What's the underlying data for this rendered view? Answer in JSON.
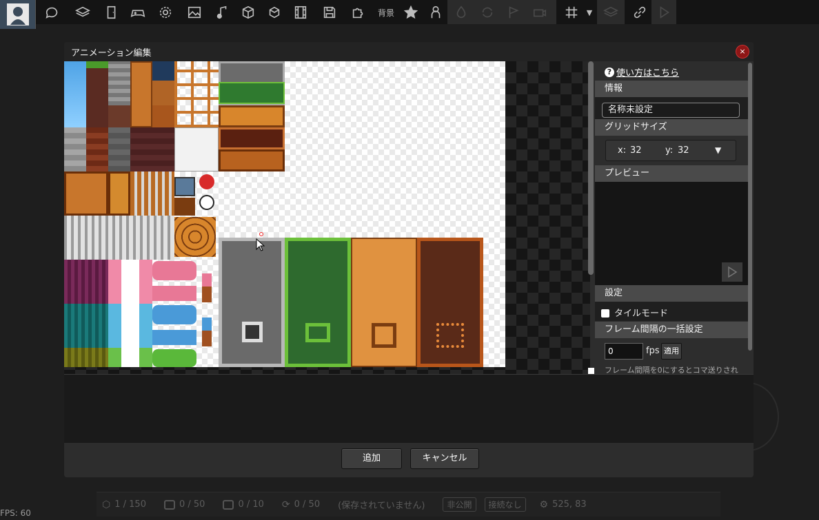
{
  "toolbar": {
    "icons": [
      "chat-icon",
      "layers-icon",
      "door-icon",
      "gamepad-icon",
      "gear-icon",
      "image-icon",
      "music-icon",
      "cube-icon",
      "box-icon",
      "film-icon",
      "save-icon",
      "puzzle-icon",
      "star-icon",
      "person-icon",
      "grid-icon",
      "link-icon"
    ],
    "bg_label": "背景"
  },
  "dialog": {
    "title": "アニメーション編集",
    "close": "×"
  },
  "panel": {
    "help_q": "?",
    "help_link": "使い方はこちら",
    "info_header": "情報",
    "name_value": "名称未設定",
    "grid_header": "グリッドサイズ",
    "grid_x_label": "x:",
    "grid_x": "32",
    "grid_y_label": "y:",
    "grid_y": "32",
    "dropdown_arrow": "▼",
    "preview_header": "プレビュー",
    "settings_header": "設定",
    "tile_mode_label": "タイルモード",
    "frame_header": "フレーム間隔の一括設定",
    "fps_value": "0",
    "fps_unit": "fps",
    "apply_label": "適用",
    "hint": "フレーム間隔を0にするとコマ送りされ"
  },
  "footer": {
    "add_label": "追加",
    "cancel_label": "キャンセル"
  },
  "status": {
    "objects": "1 / 150",
    "frames": "0 / 50",
    "images": "0 / 10",
    "animations": "0 / 50",
    "save_state": "(保存されていません)",
    "visibility": "非公開",
    "connection": "接続なし",
    "coords": "525, 83"
  },
  "fps_display": "FPS: 60",
  "colors": {
    "accent_close": "#8e1616",
    "section_bg": "#4a4a4a",
    "dialog_bg": "#2d2d2d"
  }
}
